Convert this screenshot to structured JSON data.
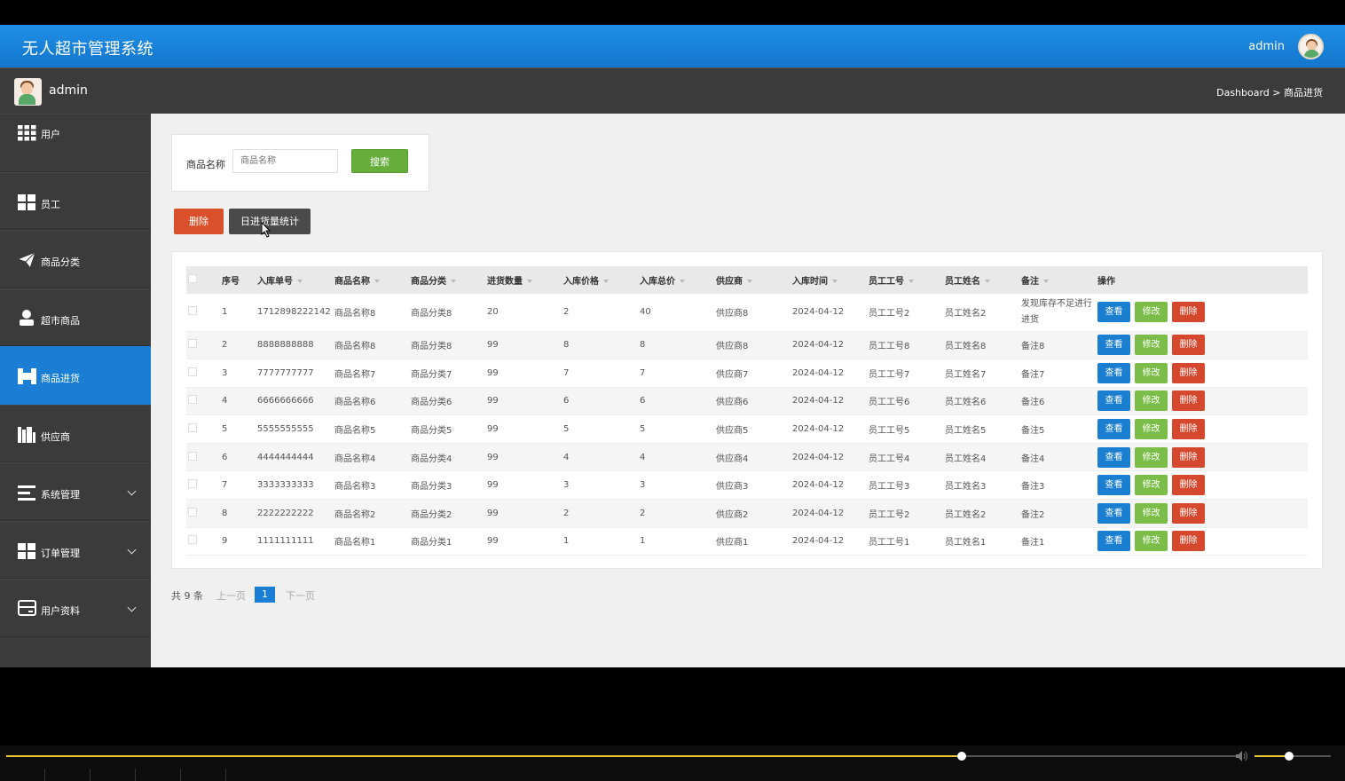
{
  "header": {
    "app_title": "无人超市管理系统",
    "user": "admin"
  },
  "subbar": {
    "username": "admin",
    "breadcrumb": "Dashboard > 商品进货"
  },
  "sidebar": {
    "items": [
      {
        "label": "用户",
        "icon": "grid-icon"
      },
      {
        "label": "员工",
        "icon": "tiles-icon"
      },
      {
        "label": "商品分类",
        "icon": "send-icon"
      },
      {
        "label": "超市商品",
        "icon": "person-icon"
      },
      {
        "label": "商品进货",
        "icon": "film-icon",
        "active": true
      },
      {
        "label": "供应商",
        "icon": "bars-icon"
      },
      {
        "label": "系统管理",
        "icon": "list-icon",
        "expandable": true
      },
      {
        "label": "订单管理",
        "icon": "tiles-icon",
        "expandable": true
      },
      {
        "label": "用户资料",
        "icon": "card-icon",
        "expandable": true
      }
    ]
  },
  "search": {
    "label": "商品名称",
    "placeholder": "商品名称",
    "button": "搜索"
  },
  "actions": {
    "delete": "删除",
    "stats": "日进货量统计"
  },
  "table": {
    "headers": [
      "序号",
      "入库单号",
      "商品名称",
      "商品分类",
      "进货数量",
      "入库价格",
      "入库总价",
      "供应商",
      "入库时间",
      "员工工号",
      "员工姓名",
      "备注",
      "操作"
    ],
    "ops": {
      "view": "查看",
      "edit": "修改",
      "delete": "删除"
    },
    "rows": [
      [
        "1",
        "1712898222142",
        "商品名称8",
        "商品分类8",
        "20",
        "2",
        "40",
        "供应商8",
        "2024-04-12",
        "员工工号2",
        "员工姓名2",
        "发现库存不足进行进货"
      ],
      [
        "2",
        "8888888888",
        "商品名称8",
        "商品分类8",
        "99",
        "8",
        "8",
        "供应商8",
        "2024-04-12",
        "员工工号8",
        "员工姓名8",
        "备注8"
      ],
      [
        "3",
        "7777777777",
        "商品名称7",
        "商品分类7",
        "99",
        "7",
        "7",
        "供应商7",
        "2024-04-12",
        "员工工号7",
        "员工姓名7",
        "备注7"
      ],
      [
        "4",
        "6666666666",
        "商品名称6",
        "商品分类6",
        "99",
        "6",
        "6",
        "供应商6",
        "2024-04-12",
        "员工工号6",
        "员工姓名6",
        "备注6"
      ],
      [
        "5",
        "5555555555",
        "商品名称5",
        "商品分类5",
        "99",
        "5",
        "5",
        "供应商5",
        "2024-04-12",
        "员工工号5",
        "员工姓名5",
        "备注5"
      ],
      [
        "6",
        "4444444444",
        "商品名称4",
        "商品分类4",
        "99",
        "4",
        "4",
        "供应商4",
        "2024-04-12",
        "员工工号4",
        "员工姓名4",
        "备注4"
      ],
      [
        "7",
        "3333333333",
        "商品名称3",
        "商品分类3",
        "99",
        "3",
        "3",
        "供应商3",
        "2024-04-12",
        "员工工号3",
        "员工姓名3",
        "备注3"
      ],
      [
        "8",
        "2222222222",
        "商品名称2",
        "商品分类2",
        "99",
        "2",
        "2",
        "供应商2",
        "2024-04-12",
        "员工工号2",
        "员工姓名2",
        "备注2"
      ],
      [
        "9",
        "1111111111",
        "商品名称1",
        "商品分类1",
        "99",
        "1",
        "1",
        "供应商1",
        "2024-04-12",
        "员工工号1",
        "员工姓名1",
        "备注1"
      ]
    ]
  },
  "pagination": {
    "total": "共 9 条",
    "prev": "上一页",
    "current": "1",
    "next": "下一页"
  },
  "player": {
    "progress_fraction": 0.777,
    "volume_fraction": 0.45
  },
  "colors": {
    "primary": "#1a7fd4",
    "success": "#7cbd4a",
    "danger": "#d5482e",
    "sidebar": "#3b3b3b"
  }
}
